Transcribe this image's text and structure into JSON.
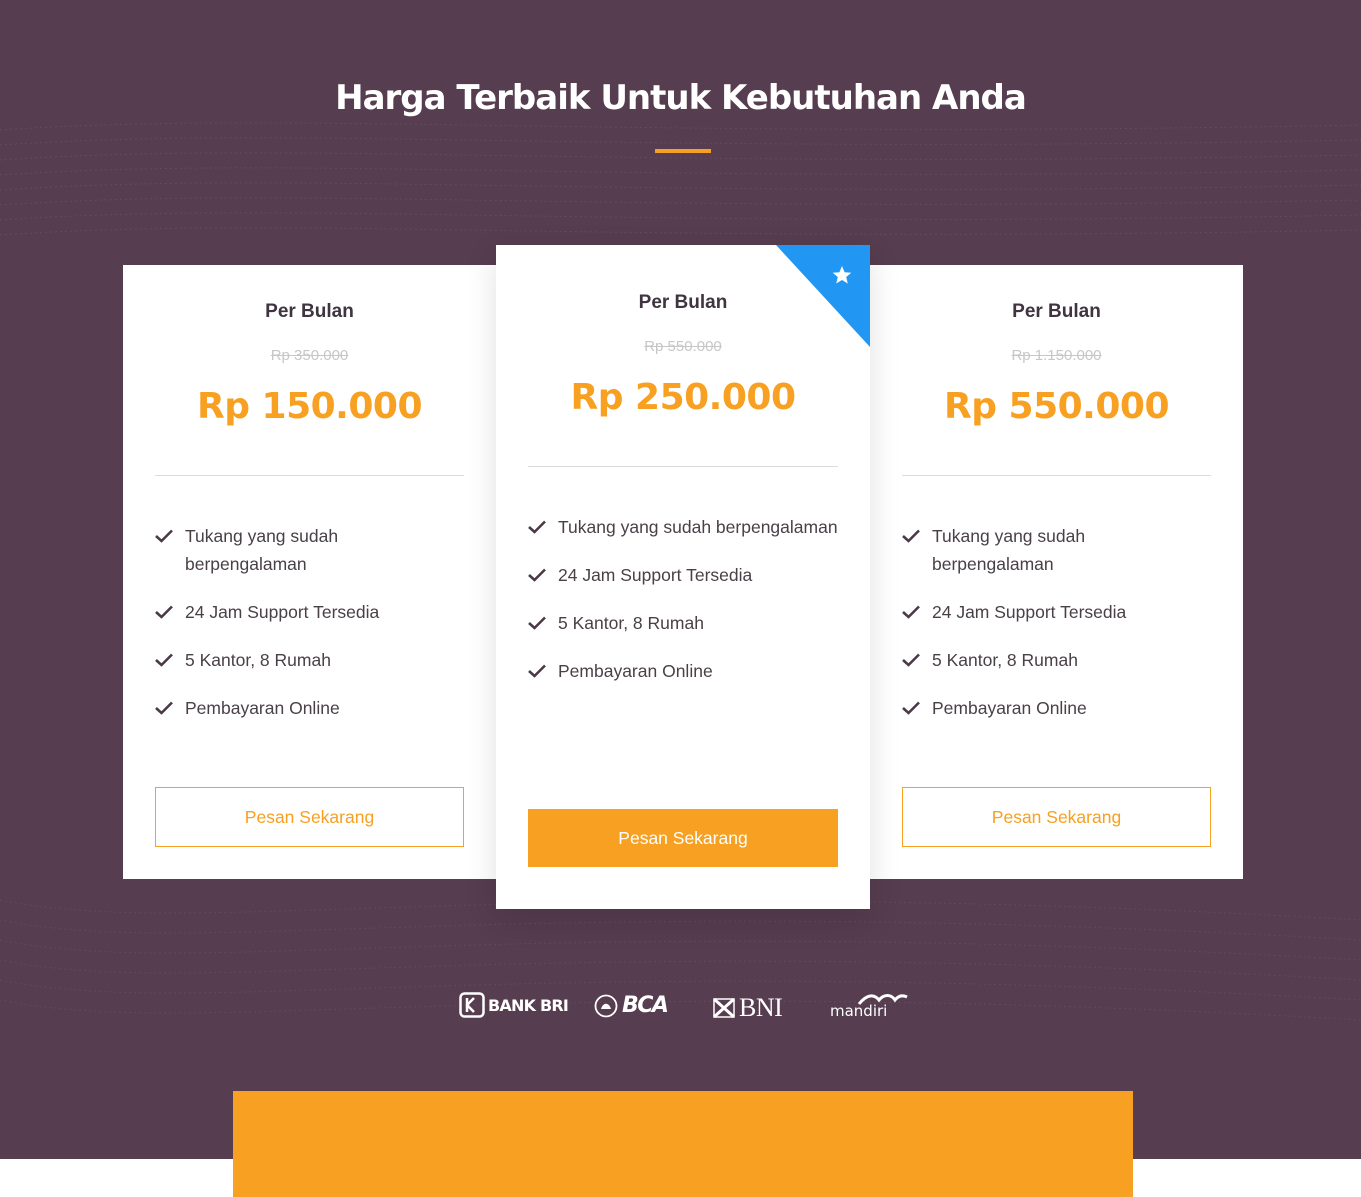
{
  "section": {
    "title": "Harga Terbaik Untuk Kebutuhan Anda"
  },
  "colors": {
    "background": "#563d4f",
    "accent": "#f7a021",
    "ribbon": "#2196f3"
  },
  "plans": [
    {
      "name": "Per Bulan",
      "old_price": "Rp 350.000",
      "price": "Rp 150.000",
      "features": [
        "Tukang yang sudah berpengalaman",
        "24 Jam Support Tersedia",
        "5 Kantor, 8 Rumah",
        "Pembayaran Online"
      ],
      "button": "Pesan Sekarang",
      "featured": false
    },
    {
      "name": "Per Bulan",
      "old_price": "Rp 550.000",
      "price": "Rp 250.000",
      "features": [
        "Tukang yang sudah berpengalaman",
        "24 Jam Support Tersedia",
        "5 Kantor, 8 Rumah",
        "Pembayaran Online"
      ],
      "button": "Pesan Sekarang",
      "featured": true,
      "badge_icon": "star-icon"
    },
    {
      "name": "Per Bulan",
      "old_price": "Rp 1.150.000",
      "price": "Rp 550.000",
      "features": [
        "Tukang yang sudah berpengalaman",
        "24 Jam Support Tersedia",
        "5 Kantor, 8 Rumah",
        "Pembayaran Online"
      ],
      "button": "Pesan Sekarang",
      "featured": false
    }
  ],
  "payment_logos": [
    {
      "name": "BANK BRI",
      "icon": "bri-logo"
    },
    {
      "name": "BCA",
      "icon": "bca-logo"
    },
    {
      "name": "BNI",
      "icon": "bni-logo"
    },
    {
      "name": "mandiri",
      "icon": "mandiri-logo"
    }
  ]
}
